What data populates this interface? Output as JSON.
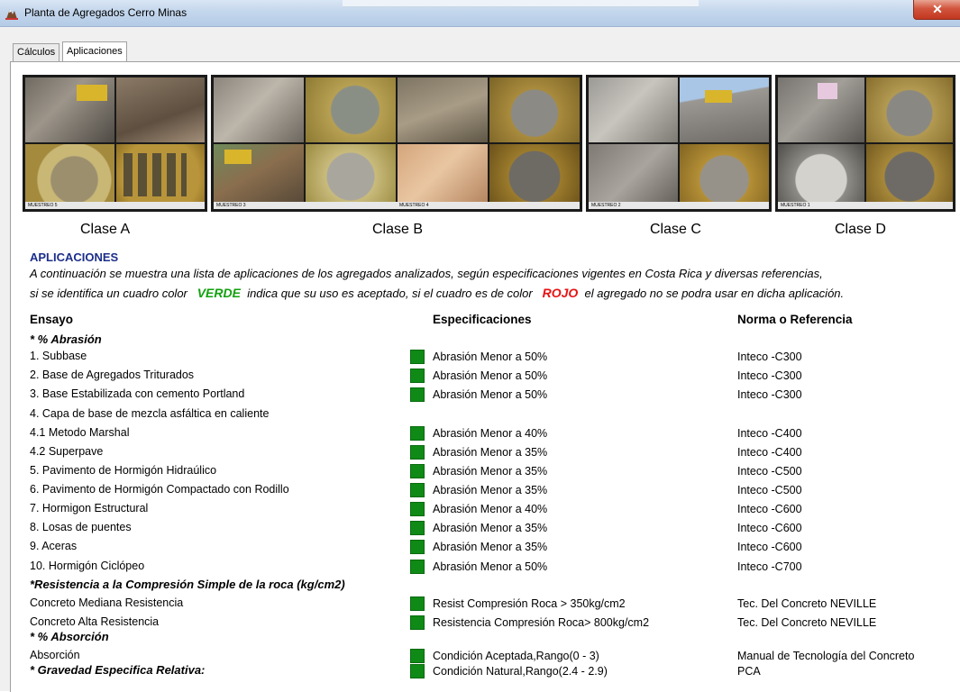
{
  "window": {
    "title": "Planta de Agregados Cerro Minas",
    "close_label": "✕"
  },
  "tabs": [
    {
      "label": "Cálculos",
      "active": false
    },
    {
      "label": "Aplicaciones",
      "active": true
    }
  ],
  "classes": [
    {
      "caption": "Clase A",
      "photo_labels": [
        "MUESTREO 5"
      ]
    },
    {
      "caption": "Clase B",
      "photo_labels": [
        "MUESTREO 3",
        "MUESTREO 4"
      ]
    },
    {
      "caption": "Clase C",
      "photo_labels": [
        "MUESTREO 2"
      ]
    },
    {
      "caption": "Clase D",
      "photo_labels": [
        "MUESTREO 1"
      ]
    }
  ],
  "section_title": "APLICACIONES",
  "intro": {
    "line1": "A continuación se muestra una lista de aplicaciones de los agregados analizados, según especificaciones vigentes en Costa Rica y diversas referencias,",
    "line2_a": "si se identifica un cuadro color",
    "verde": "VERDE",
    "line2_b": "indica que su uso es aceptado, si el cuadro es de color",
    "rojo": "ROJO",
    "line2_c": "el agregado no se podra usar en dicha aplicación."
  },
  "columns": {
    "ensayo": "Ensayo",
    "spec": "Especificaciones",
    "norma": "Norma o Referencia"
  },
  "status_colors": {
    "accepted": "#0f8a16",
    "rejected": "#e81212"
  },
  "rows": [
    {
      "ensayo": "* % Abrasión",
      "section": true
    },
    {
      "ensayo": "1. Subbase",
      "status": "accepted",
      "spec": "Abrasión Menor a 50%",
      "norma": "Inteco -C300"
    },
    {
      "ensayo": "2. Base de Agregados Triturados",
      "status": "accepted",
      "spec": "Abrasión Menor a 50%",
      "norma": "Inteco -C300"
    },
    {
      "ensayo": "3. Base Estabilizada con cemento Portland",
      "status": "accepted",
      "spec": "Abrasión Menor a 50%",
      "norma": "Inteco -C300"
    },
    {
      "ensayo": "4. Capa de base de mezcla asfáltica en caliente"
    },
    {
      "ensayo": "4.1 Metodo Marshal",
      "status": "accepted",
      "spec": "Abrasión Menor a 40%",
      "norma": "Inteco -C400"
    },
    {
      "ensayo": "4.2 Superpave",
      "status": "accepted",
      "spec": "Abrasión Menor a 35%",
      "norma": "Inteco -C400"
    },
    {
      "ensayo": "5. Pavimento de Hormigón Hidraúlico",
      "status": "accepted",
      "spec": "Abrasión Menor a 35%",
      "norma": "Inteco -C500"
    },
    {
      "ensayo": "6. Pavimento de Hormigón Compactado con Rodillo",
      "status": "accepted",
      "spec": "Abrasión Menor a 35%",
      "norma": "Inteco -C500"
    },
    {
      "ensayo": "7. Hormigon Estructural",
      "status": "accepted",
      "spec": "Abrasión Menor a 40%",
      "norma": "Inteco -C600"
    },
    {
      "ensayo": "8. Losas  de puentes",
      "status": "accepted",
      "spec": "Abrasión Menor a 35%",
      "norma": "Inteco -C600"
    },
    {
      "ensayo": "9. Aceras",
      "status": "accepted",
      "spec": "Abrasión Menor a 35%",
      "norma": "Inteco -C600"
    },
    {
      "ensayo": "10. Hormigón Ciclópeo",
      "status": "accepted",
      "spec": "Abrasión Menor a 50%",
      "norma": "Inteco -C700"
    },
    {
      "ensayo": "*Resistencia a la Compresión Simple de la roca (kg/cm2)",
      "section": true
    },
    {
      "ensayo": "Concreto Mediana Resistencia",
      "status": "accepted",
      "spec": "Resist Compresión Roca  > 350kg/cm2",
      "norma": "Tec. Del Concreto NEVILLE"
    },
    {
      "ensayo": "Concreto Alta Resistencia",
      "status": "accepted",
      "spec": "Resistencia Compresión Roca> 800kg/cm2",
      "norma": "Tec. Del Concreto NEVILLE"
    },
    {
      "ensayo": "* % Absorción",
      "section": true
    },
    {
      "ensayo": "Absorción",
      "status": "accepted",
      "spec": "Condición Aceptada,Rango(0 - 3)",
      "norma": "Manual de Tecnología del Concreto"
    },
    {
      "ensayo": "* Gravedad Especifica Relativa:",
      "section": true,
      "status": "accepted",
      "spec": "Condición Natural,Rango(2.4 - 2.9)",
      "norma": "PCA"
    }
  ]
}
